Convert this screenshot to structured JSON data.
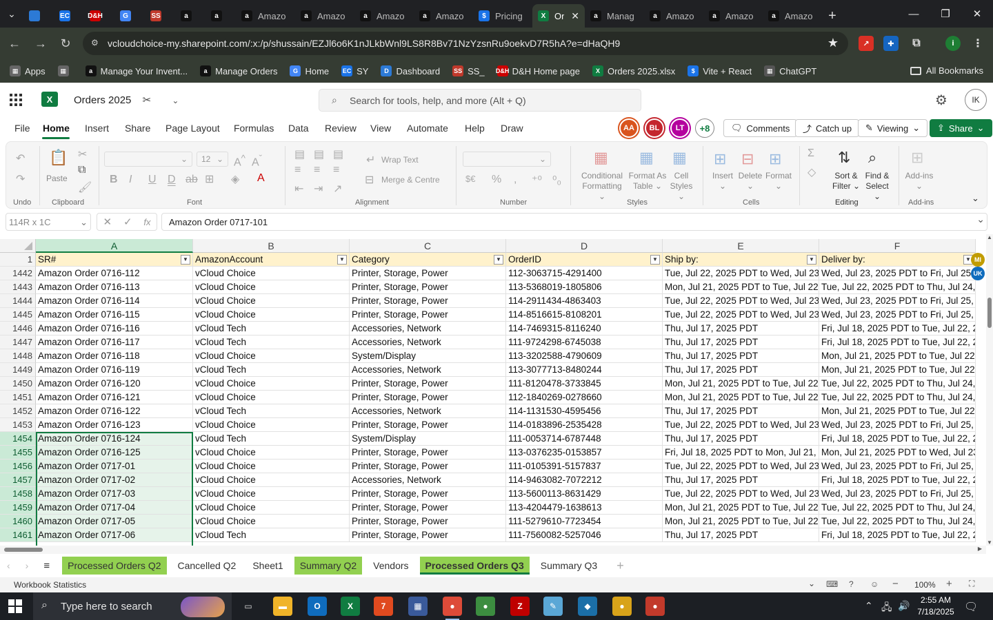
{
  "browser": {
    "tabs": [
      {
        "title": "",
        "icon": "gear-icon",
        "color": "#2c7ad6"
      },
      {
        "title": "",
        "icon": "EC",
        "color": "#1a73e8"
      },
      {
        "title": "",
        "icon": "D&H",
        "color": "#c00"
      },
      {
        "title": "",
        "icon": "G",
        "color": "#4285f4"
      },
      {
        "title": "",
        "icon": "SS",
        "color": "#c0392b"
      },
      {
        "title": "",
        "icon": "a",
        "color": "#111"
      },
      {
        "title": "",
        "icon": "a",
        "color": "#111"
      },
      {
        "title": "Amazo",
        "icon": "a",
        "color": "#111"
      },
      {
        "title": "Amazo",
        "icon": "a",
        "color": "#111"
      },
      {
        "title": "Amazo",
        "icon": "a",
        "color": "#111"
      },
      {
        "title": "Amazo",
        "icon": "a",
        "color": "#111"
      },
      {
        "title": "Pricing",
        "icon": "$",
        "color": "#1a73e8"
      },
      {
        "title": "Or",
        "icon": "X",
        "color": "#107c41",
        "active": true
      },
      {
        "title": "Manag",
        "icon": "a",
        "color": "#111"
      },
      {
        "title": "Amazo",
        "icon": "a",
        "color": "#111"
      },
      {
        "title": "Amazo",
        "icon": "a",
        "color": "#111"
      },
      {
        "title": "Amazo",
        "icon": "a",
        "color": "#111"
      }
    ],
    "new_tab": "+",
    "url": "vcloudchoice-my.sharepoint.com/:x:/p/shussain/EZJl6o6K1nJLkbWnl9LS8R8Bv71NzYzsnRu9oekvD7R5hA?e=dHaQH9",
    "bookmarks": [
      {
        "label": "Apps",
        "icon": "apps-icon",
        "color": "#666"
      },
      {
        "label": "",
        "icon": "grid-icon",
        "color": "#666"
      },
      {
        "label": "Manage Your Invent...",
        "icon": "a",
        "color": "#111"
      },
      {
        "label": "Manage Orders",
        "icon": "a",
        "color": "#111"
      },
      {
        "label": "Home",
        "icon": "G",
        "color": "#4285f4"
      },
      {
        "label": "SY",
        "icon": "EC",
        "color": "#1a73e8"
      },
      {
        "label": "Dashboard",
        "icon": "D",
        "color": "#2c7ad6"
      },
      {
        "label": "SS_",
        "icon": "SS",
        "color": "#c0392b"
      },
      {
        "label": "D&H Home page",
        "icon": "D&H",
        "color": "#c00"
      },
      {
        "label": "Orders 2025.xlsx",
        "icon": "X",
        "color": "#107c41"
      },
      {
        "label": "Vite + React",
        "icon": "$",
        "color": "#1a73e8"
      },
      {
        "label": "ChatGPT",
        "icon": "chatgpt-icon",
        "color": "#555"
      }
    ],
    "all_bookmarks": "All Bookmarks"
  },
  "excel": {
    "doc_title": "Orders 2025",
    "search_placeholder": "Search for tools, help, and more (Alt + Q)",
    "avatar_initials": "IK",
    "menu": [
      "File",
      "Home",
      "Insert",
      "Share",
      "Page Layout",
      "Formulas",
      "Data",
      "Review",
      "View",
      "Automate",
      "Help",
      "Draw"
    ],
    "coauthors": [
      {
        "initials": "AA",
        "color": "#d9541e"
      },
      {
        "initials": "BL",
        "color": "#c4262e"
      },
      {
        "initials": "LT",
        "color": "#b4009e"
      }
    ],
    "coauthors_more": "+8",
    "comments": "Comments",
    "catch_up": "Catch up",
    "viewing": "Viewing",
    "share": "Share",
    "ribbon": {
      "undo_group": "Undo",
      "clipboard_group": "Clipboard",
      "paste": "Paste",
      "font_group": "Font",
      "font_size": "12",
      "alignment_group": "Alignment",
      "wrap_text": "Wrap Text",
      "merge_centre": "Merge & Centre",
      "number_group": "Number",
      "styles_group": "Styles",
      "conditional_formatting": [
        "Conditional",
        "Formatting"
      ],
      "format_as_table": [
        "Format As",
        "Table"
      ],
      "cell_styles": [
        "Cell",
        "Styles"
      ],
      "cells_group": "Cells",
      "insert": "Insert",
      "delete": "Delete",
      "format": "Format",
      "editing_group": "Editing",
      "sort_filter": [
        "Sort &",
        "Filter"
      ],
      "find_select": [
        "Find &",
        "Select"
      ],
      "addins_group": "Add-ins",
      "addins": "Add-ins"
    },
    "name_box": "114R x 1C",
    "formula": "Amazon Order 0717-101",
    "columns": [
      "A",
      "B",
      "C",
      "D",
      "E",
      "F"
    ],
    "header_row_num": "1",
    "headers": [
      "SR#",
      "AmazonAccount",
      "Category",
      "OrderID",
      "Ship by:",
      "Deliver by:"
    ],
    "rows": [
      {
        "n": "1442",
        "a": "Amazon Order 0716-112",
        "b": " vCloud Choice",
        "c": " Printer, Storage, Power",
        "d": " 112-3063715-4291400",
        "e": " Tue, Jul 22, 2025 PDT to Wed, Jul 23, 2",
        "f": " Wed, Jul 23, 2025 PDT to Fri, Jul 25, 20"
      },
      {
        "n": "1443",
        "a": "Amazon Order 0716-113",
        "b": " vCloud Choice",
        "c": " Printer, Storage, Power",
        "d": "113-5368019-1805806",
        "e": "Mon, Jul 21, 2025 PDT to Tue, Jul 22, 2",
        "f": "Tue, Jul 22, 2025 PDT to Thu, Jul 24, 20 W"
      },
      {
        "n": "1444",
        "a": "Amazon Order 0716-114",
        "b": " vCloud Choice",
        "c": " Printer, Storage, Power",
        "d": " 114-2911434-4863403",
        "e": " Tue, Jul 22, 2025 PDT to Wed, Jul 23, 2",
        "f": " Wed, Jul 23, 2025 PDT to Fri, Jul 25, 2 W"
      },
      {
        "n": "1445",
        "a": "Amazon Order 0716-115",
        "b": "vCloud Choice",
        "c": "Printer, Storage, Power",
        "d": "114-8516615-8108201",
        "e": "Tue, Jul 22, 2025 PDT to Wed, Jul 23, 2",
        "f": "Wed, Jul 23, 2025 PDT to Fri, Jul 25, 20 W"
      },
      {
        "n": "1446",
        "a": "Amazon Order 0716-116",
        "b": " vCloud Tech",
        "c": " Accessories, Network",
        "d": " 114-7469315-8116240",
        "e": " Thu, Jul 17, 2025 PDT",
        "f": "Fri, Jul 18, 2025 PDT to Tue, Jul 22, 20 W"
      },
      {
        "n": "1447",
        "a": "Amazon Order 0716-117",
        "b": " vCloud Tech",
        "c": " Accessories, Network",
        "d": " 111-9724298-6745038",
        "e": " Thu, Jul 17, 2025 PDT",
        "f": "Fri, Jul 18, 2025 PDT to Tue, Jul 22, 20 W"
      },
      {
        "n": "1448",
        "a": "Amazon Order 0716-118",
        "b": "vCloud Choice",
        "c": "System/Display",
        "d": "113-3202588-4790609",
        "e": "Thu, Jul 17, 2025 PDT",
        "f": "Mon, Jul 21, 2025 PDT to Tue, Jul 22, 2 Th"
      },
      {
        "n": "1449",
        "a": "Amazon Order 0716-119",
        "b": " vCloud Tech",
        "c": " Accessories, Network",
        "d": "113-3077713-8480244",
        "e": "Thu, Jul 17, 2025 PDT",
        "f": "Mon, Jul 21, 2025 PDT to Tue, Jul 22, 2 W"
      },
      {
        "n": "1450",
        "a": "Amazon Order 0716-120",
        "b": "vCloud Choice",
        "c": "Printer, Storage, Power",
        "d": "111-8120478-3733845",
        "e": "Mon, Jul 21, 2025 PDT to Tue, Jul 22, 2",
        "f": "Tue, Jul 22, 2025 PDT to Thu, Jul 24, 20 W"
      },
      {
        "n": "1451",
        "a": "Amazon Order 0716-121",
        "b": "vCloud Choice",
        "c": "Printer, Storage, Power",
        "d": "112-1840269-0278660",
        "e": "Mon, Jul 21, 2025 PDT to Tue, Jul 22, 2",
        "f": "Tue, Jul 22, 2025 PDT to Thu, Jul 24, 20 Tu"
      },
      {
        "n": "1452",
        "a": "Amazon Order 0716-122",
        "b": " vCloud Tech",
        "c": "Accessories, Network",
        "d": "114-1131530-4595456",
        "e": "Thu, Jul 17, 2025 PDT",
        "f": "Mon, Jul 21, 2025 PDT to Tue, Jul 22, 2 W"
      },
      {
        "n": "1453",
        "a": "Amazon Order 0716-123",
        "b": "vCloud Choice",
        "c": "Printer, Storage, Power",
        "d": "114-0183896-2535428",
        "e": "Tue, Jul 22, 2025 PDT to Wed, Jul 23, 2",
        "f": "Wed, Jul 23, 2025 PDT to Fri, Jul 25, 20 W"
      },
      {
        "n": "1454",
        "a": "Amazon Order 0716-124",
        "b": "vCloud Tech",
        "c": "System/Display",
        "d": "111-0053714-6787448",
        "e": "Thu, Jul 17, 2025 PDT",
        "f": "Fri, Jul 18, 2025 PDT to Tue, Jul 22, 20 W",
        "sel": true
      },
      {
        "n": "1455",
        "a": "Amazon Order 0716-125",
        "b": "vCloud Choice",
        "c": "Printer, Storage, Power",
        "d": "113-0376235-0153857",
        "e": "Fri, Jul 18, 2025 PDT to Mon, Jul 21, 20",
        "f": "Mon, Jul 21, 2025 PDT to Wed, Jul 23, Tu",
        "sel": true
      },
      {
        "n": "1456",
        "a": "Amazon Order 0717-01",
        "b": "vCloud Choice",
        "c": "Printer, Storage, Power",
        "d": "111-0105391-5157837",
        "e": "Tue, Jul 22, 2025 PDT to Wed, Jul 23, 2",
        "f": "Wed, Jul 23, 2025 PDT to Fri, Jul 25, 20 W",
        "sel": true
      },
      {
        "n": "1457",
        "a": "Amazon Order 0717-02",
        "b": "vCloud Choice",
        "c": "Accessories, Network",
        "d": "114-9463082-7072212",
        "e": "Thu, Jul 17, 2025 PDT",
        "f": "Fri, Jul 18, 2025 PDT to Tue, Jul 22, 20 W",
        "sel": true
      },
      {
        "n": "1458",
        "a": "Amazon Order 0717-03",
        "b": "vCloud Choice",
        "c": "Printer, Storage, Power",
        "d": "113-5600113-8631429",
        "e": "Tue, Jul 22, 2025 PDT to Wed, Jul 23, 2",
        "f": "Wed, Jul 23, 2025 PDT to Fri, Jul 25, 20 W",
        "sel": true
      },
      {
        "n": "1459",
        "a": "Amazon Order 0717-04",
        "b": "vCloud Choice",
        "c": "Printer, Storage, Power",
        "d": "113-4204479-1638613",
        "e": "Mon, Jul 21, 2025 PDT to Tue, Jul 22, 2",
        "f": "Tue, Jul 22, 2025 PDT to Thu, Jul 24, 20 W",
        "sel": true
      },
      {
        "n": "1460",
        "a": "Amazon Order 0717-05",
        "b": "vCloud Choice",
        "c": "Printer, Storage, Power",
        "d": "111-5279610-7723454",
        "e": "Mon, Jul 21, 2025 PDT to Tue, Jul 22, 2",
        "f": "Tue, Jul 22, 2025 PDT to Thu, Jul 24, 20 W",
        "sel": true
      },
      {
        "n": "1461",
        "a": "Amazon Order 0717-06",
        "b": "vCloud Tech",
        "c": "Printer, Storage, Power",
        "d": "111-7560082-5257046",
        "e": "Thu, Jul 17, 2025 PDT",
        "f": "Fri, Jul 18, 2025 PDT to Tue, Jul 22, 20 W",
        "sel": true
      }
    ],
    "presence": [
      {
        "initials": "MI",
        "color": "#c19c00"
      },
      {
        "initials": "UK",
        "color": "#0f6cbd"
      }
    ],
    "sheet_tabs": [
      {
        "label": "Processed Orders Q2",
        "green": true
      },
      {
        "label": "Cancelled Q2"
      },
      {
        "label": "Sheet1"
      },
      {
        "label": "Summary Q2",
        "green": true
      },
      {
        "label": "Vendors"
      },
      {
        "label": "Processed Orders Q3",
        "green": true,
        "active": true
      },
      {
        "label": "Summary Q3"
      }
    ],
    "add_sheet": "+",
    "status_left": "Workbook Statistics",
    "zoom": "100%"
  },
  "taskbar": {
    "search_placeholder": "Type here to search",
    "time": "2:55 AM",
    "date": "7/18/2025",
    "apps": [
      {
        "name": "task-view",
        "label": "▭",
        "color": "transparent"
      },
      {
        "name": "file-explorer",
        "label": "▬",
        "color": "#f0b429"
      },
      {
        "name": "outlook",
        "label": "O",
        "color": "#0f6cbd"
      },
      {
        "name": "excel",
        "label": "X",
        "color": "#107c41"
      },
      {
        "name": "app-7",
        "label": "7",
        "color": "#e04a1f"
      },
      {
        "name": "calculator",
        "label": "▦",
        "color": "#3a5a9a"
      },
      {
        "name": "chrome-1",
        "label": "●",
        "color": "#dd4b39",
        "active": true
      },
      {
        "name": "chrome-2",
        "label": "●",
        "color": "#3c8d40"
      },
      {
        "name": "filezilla",
        "label": "Z",
        "color": "#bf0000"
      },
      {
        "name": "notepad",
        "label": "✎",
        "color": "#5aa7d6"
      },
      {
        "name": "app-diamond",
        "label": "◆",
        "color": "#1b6fa8"
      },
      {
        "name": "chrome-3",
        "label": "●",
        "color": "#d8a31a"
      },
      {
        "name": "chrome-4",
        "label": "●",
        "color": "#c23a2b"
      }
    ]
  }
}
